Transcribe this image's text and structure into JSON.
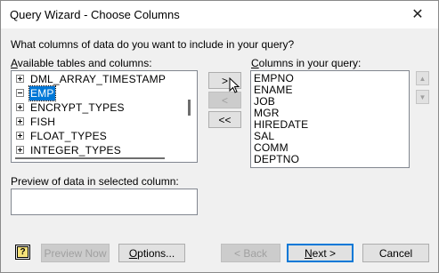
{
  "window": {
    "title": "Query Wizard - Choose Columns",
    "close_glyph": "✕"
  },
  "prompt": "What columns of data do you want to include in your query?",
  "available": {
    "label_u": "A",
    "label_rest": "vailable tables and columns:",
    "items": [
      {
        "label": "DML_ARRAY_TIMESTAMP",
        "expander": "plus",
        "selected": false
      },
      {
        "label": "EMP",
        "expander": "minus",
        "selected": true
      },
      {
        "label": "ENCRYPT_TYPES",
        "expander": "plus",
        "selected": false
      },
      {
        "label": "FISH",
        "expander": "plus",
        "selected": false
      },
      {
        "label": "FLOAT_TYPES",
        "expander": "plus",
        "selected": false
      },
      {
        "label": "INTEGER_TYPES",
        "expander": "plus",
        "selected": false
      }
    ]
  },
  "move_buttons": {
    "add": ">",
    "remove": "<",
    "remove_all": "<<"
  },
  "columns": {
    "label_u": "C",
    "label_rest": "olumns in your query:",
    "items": [
      "EMPNO",
      "ENAME",
      "JOB",
      "MGR",
      "HIREDATE",
      "SAL",
      "COMM",
      "DEPTNO"
    ]
  },
  "order_buttons": {
    "up_glyph": "▲",
    "down_glyph": "▼"
  },
  "preview": {
    "label": "Preview of data in selected column:",
    "value": ""
  },
  "footer": {
    "help_glyph": "?",
    "preview_now": "Preview Now",
    "options_u": "O",
    "options_rest": "ptions...",
    "back": "< Back",
    "next_u": "N",
    "next_rest": "ext >",
    "cancel": "Cancel"
  }
}
